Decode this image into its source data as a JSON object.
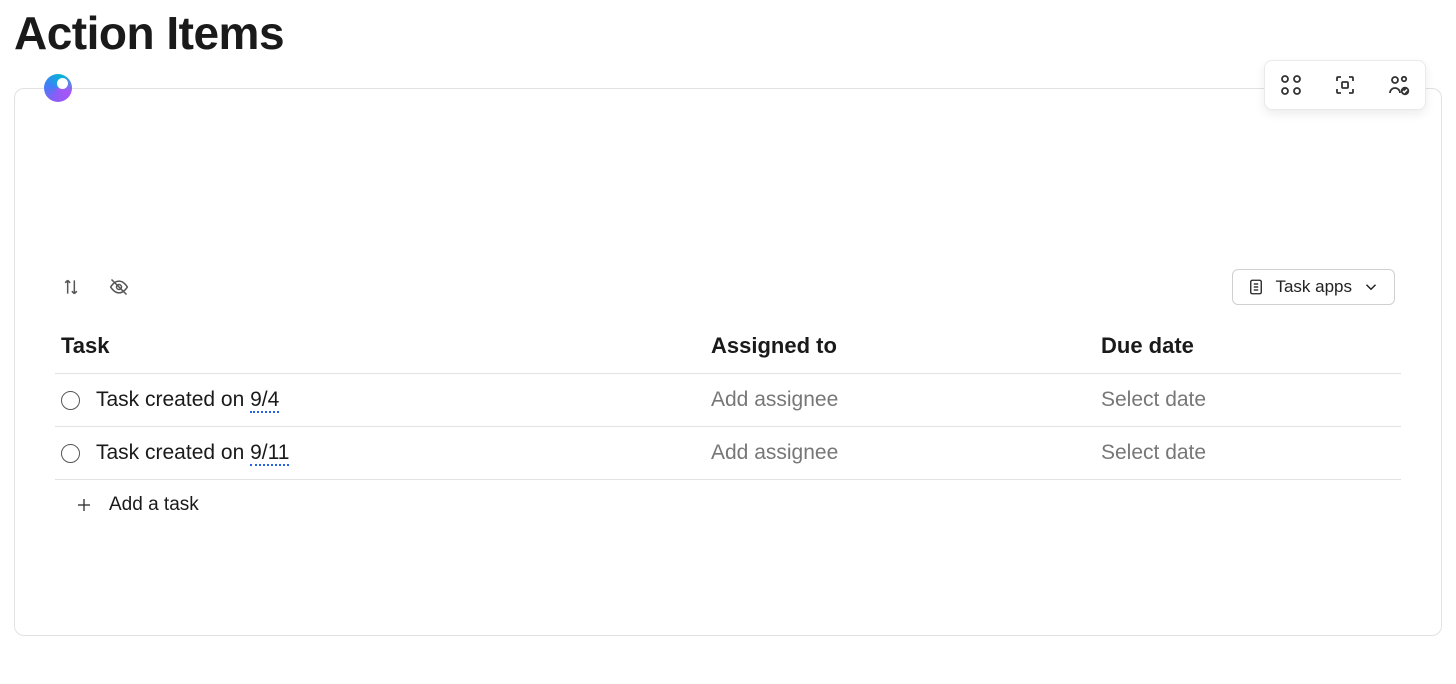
{
  "page": {
    "title": "Action Items"
  },
  "controls": {
    "task_apps_label": "Task apps"
  },
  "columns": {
    "task": "Task",
    "assigned": "Assigned to",
    "due": "Due date"
  },
  "tasks": [
    {
      "name_prefix": "Task created on ",
      "name_date": "9/4",
      "assignee_placeholder": "Add assignee",
      "due_placeholder": "Select date"
    },
    {
      "name_prefix": "Task created on ",
      "name_date": "9/11",
      "assignee_placeholder": "Add assignee",
      "due_placeholder": "Select date"
    }
  ],
  "add_task": {
    "label": "Add a task"
  }
}
